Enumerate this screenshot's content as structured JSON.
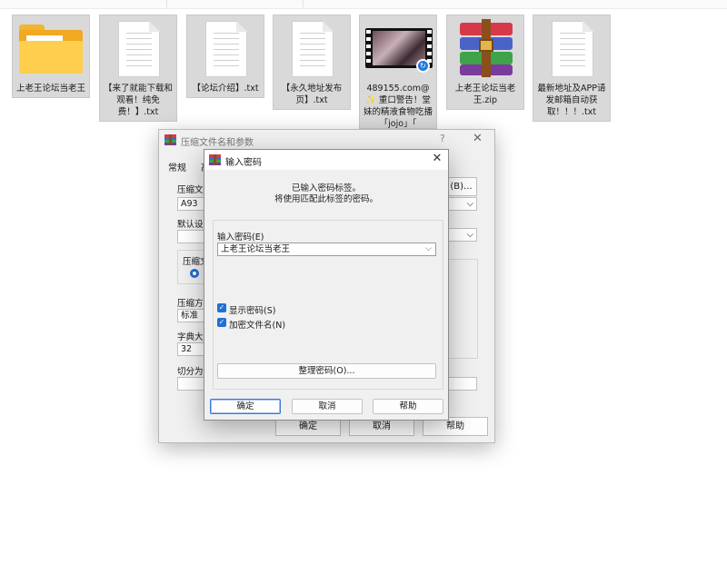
{
  "files": [
    {
      "name": "上老王论坛当老王",
      "type": "folder"
    },
    {
      "name": "【来了就能下载和观看！纯免费！】.txt",
      "type": "text"
    },
    {
      "name": "【论坛介绍】.txt",
      "type": "text"
    },
    {
      "name": "【永久地址发布页】.txt",
      "type": "text"
    },
    {
      "name": "489155.com@✨ 重口警告！堂妹的精液食物吃播「jojo」「",
      "type": "video",
      "badge_icon": "sync-icon"
    },
    {
      "name": "上老王论坛当老王.zip",
      "type": "archive"
    },
    {
      "name": "最新地址及APP请发邮箱自动获取！！！.txt",
      "type": "text"
    }
  ],
  "back_dialog": {
    "title": "压缩文件名和参数",
    "help_glyph": "?",
    "close_glyph": "✕",
    "tab_general": "常规",
    "tab_second_partial": "高",
    "archive_name_label": "压缩文件",
    "archive_name_value": "A93",
    "browse_button": "(B)...",
    "default_profile_label": "默认设置",
    "format_label": "压缩文",
    "method_label": "压缩方",
    "method_value": "标准",
    "dict_label": "字典大小",
    "dict_value": "32",
    "split_label": "切分为分",
    "ok": "确定",
    "cancel": "取消",
    "help": "帮助"
  },
  "password_dialog": {
    "title": "输入密码",
    "close_glyph": "✕",
    "message_line1": "已输入密码标签。",
    "message_line2": "将使用匹配此标签的密码。",
    "password_label": "输入密码(E)",
    "password_value": "上老王论坛当老王",
    "show_password_label": "显示密码(S)",
    "show_password_checked": true,
    "encrypt_filenames_label": "加密文件名(N)",
    "encrypt_filenames_checked": true,
    "organize_button": "整理密码(O)...",
    "ok": "确定",
    "cancel": "取消",
    "help": "帮助"
  },
  "colors": {
    "accent": "#1f6fd6",
    "selection_bg": "#d9d9d9",
    "folder": "#ffce4c"
  }
}
